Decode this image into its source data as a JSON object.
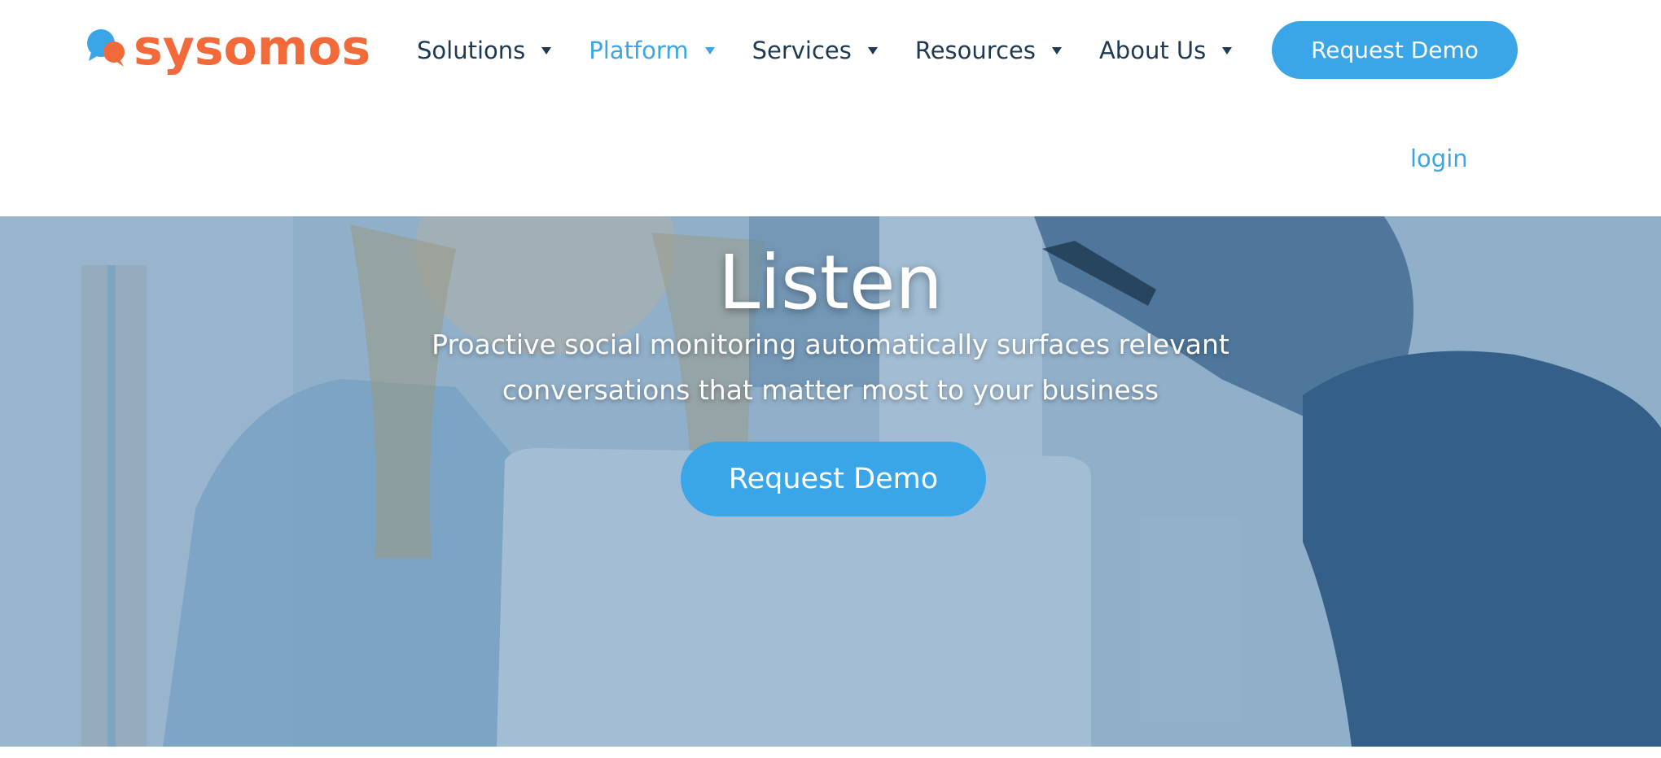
{
  "brand": {
    "name": "sysomos",
    "color": "#f26a3a",
    "accent": "#3aa6e8",
    "logo_icon": "chat-bubbles-icon"
  },
  "nav": {
    "items": [
      {
        "label": "Solutions",
        "active": false
      },
      {
        "label": "Platform",
        "active": true
      },
      {
        "label": "Services",
        "active": false
      },
      {
        "label": "Resources",
        "active": false
      },
      {
        "label": "About Us",
        "active": false
      }
    ],
    "caret_icon": "caret-down-icon",
    "cta_label": "Request Demo",
    "login_label": "login"
  },
  "hero": {
    "title": "Listen",
    "subtitle_line1": "Proactive social monitoring automatically surfaces relevant",
    "subtitle_line2": "conversations that matter most to your business",
    "cta_label": "Request Demo",
    "background": "photo of two people working at a laptop, blue tinted"
  }
}
